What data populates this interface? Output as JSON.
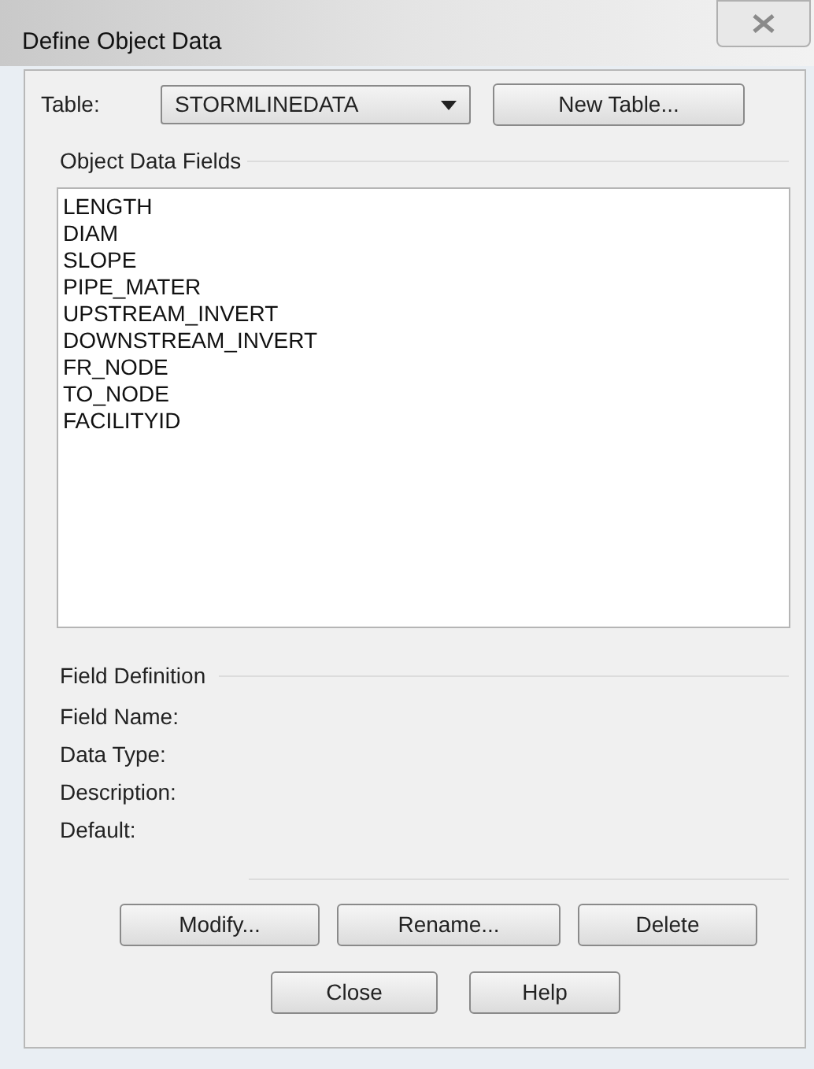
{
  "window": {
    "title": "Define Object Data"
  },
  "table_row": {
    "label": "Table:",
    "value": "STORMLINEDATA",
    "new_table_button": "New Table..."
  },
  "object_data_fields": {
    "heading": "Object Data Fields",
    "items": [
      "LENGTH",
      "DIAM",
      "SLOPE",
      "PIPE_MATER",
      "UPSTREAM_INVERT",
      "DOWNSTREAM_INVERT",
      "FR_NODE",
      "TO_NODE",
      "FACILITYID"
    ]
  },
  "field_definition": {
    "heading": "Field Definition",
    "labels": [
      "Field Name:",
      "Data Type:",
      "Description:",
      "Default:"
    ]
  },
  "buttons": [
    "Modify...",
    "Rename...",
    "Delete"
  ],
  "footer_buttons": [
    "Close",
    "Help"
  ]
}
